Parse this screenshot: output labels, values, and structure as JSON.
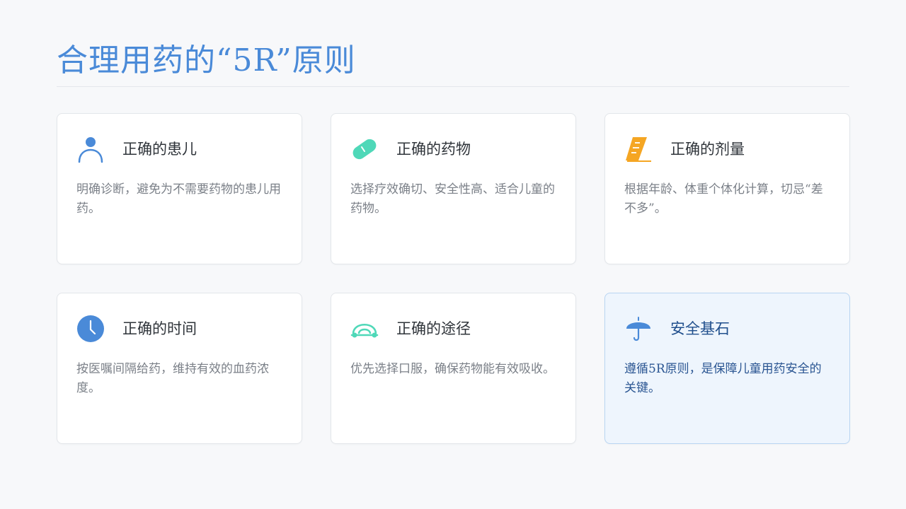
{
  "page": {
    "title": "合理用药的“5R”原则"
  },
  "cards": [
    {
      "icon": "person-icon",
      "icon_color": "#4a8ad8",
      "title": "正确的患儿",
      "desc": "明确诊断，避免为不需要药物的患儿用药。"
    },
    {
      "icon": "pill-icon",
      "icon_color": "#4fd8b8",
      "title": "正确的药物",
      "desc": "选择疗效确切、安全性高、适合儿童的药物。"
    },
    {
      "icon": "ruler-icon",
      "icon_color": "#f5a623",
      "title": "正确的剂量",
      "desc": "根据年龄、体重个体化计算，切忌“差不多”。"
    },
    {
      "icon": "clock-icon",
      "icon_color": "#4a8ad8",
      "title": "正确的时间",
      "desc": "按医嘱间隔给药，维持有效的血药浓度。"
    },
    {
      "icon": "route-icon",
      "icon_color": "#4fd8b8",
      "title": "正确的途径",
      "desc": "优先选择口服，确保药物能有效吸收。"
    },
    {
      "icon": "umbrella-icon",
      "icon_color": "#4a8ad8",
      "title": "安全基石",
      "desc": "遵循5R原则，是保障儿童用药安全的关键。"
    }
  ]
}
